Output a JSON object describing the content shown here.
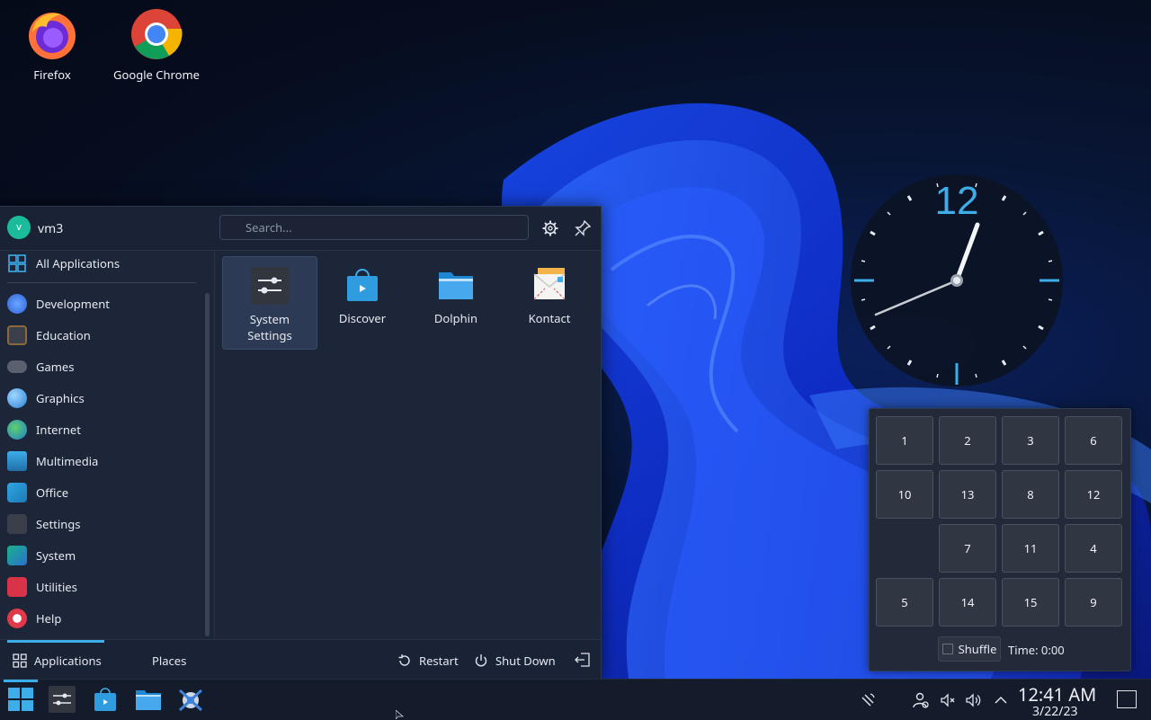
{
  "desktop": {
    "icons": [
      {
        "label": "Firefox"
      },
      {
        "label": "Google Chrome"
      }
    ]
  },
  "launcher": {
    "user": {
      "initial": "v",
      "name": "vm3"
    },
    "search": {
      "placeholder": "Search..."
    },
    "categories": [
      {
        "label": "All Applications",
        "icon": "grid-icon"
      },
      {
        "label": "Development",
        "icon": "development-icon"
      },
      {
        "label": "Education",
        "icon": "education-icon"
      },
      {
        "label": "Games",
        "icon": "games-icon"
      },
      {
        "label": "Graphics",
        "icon": "graphics-icon"
      },
      {
        "label": "Internet",
        "icon": "internet-icon"
      },
      {
        "label": "Multimedia",
        "icon": "multimedia-icon"
      },
      {
        "label": "Office",
        "icon": "office-icon"
      },
      {
        "label": "Settings",
        "icon": "settings-icon"
      },
      {
        "label": "System",
        "icon": "system-icon"
      },
      {
        "label": "Utilities",
        "icon": "utilities-icon"
      },
      {
        "label": "Help",
        "icon": "help-icon"
      }
    ],
    "favorites": [
      {
        "line1": "System",
        "line2": "Settings"
      },
      {
        "line1": "Discover",
        "line2": ""
      },
      {
        "line1": "Dolphin",
        "line2": ""
      },
      {
        "line1": "Kontact",
        "line2": ""
      }
    ],
    "footer": {
      "applications": "Applications",
      "places": "Places",
      "restart": "Restart",
      "shutdown": "Shut Down"
    }
  },
  "clock_widget": {
    "twelve": "12",
    "accent": "#3daee9"
  },
  "puzzle": {
    "tiles": [
      "1",
      "2",
      "3",
      "6",
      "10",
      "13",
      "8",
      "12",
      "",
      "7",
      "11",
      "4",
      "5",
      "14",
      "15",
      "9"
    ],
    "shuffle": "Shuffle",
    "time": "Time: 0:00"
  },
  "taskbar": {
    "time": "12:41 AM",
    "date": "3/22/23"
  },
  "colors": {
    "accent": "#3daee9",
    "panel": "#1d2639"
  }
}
